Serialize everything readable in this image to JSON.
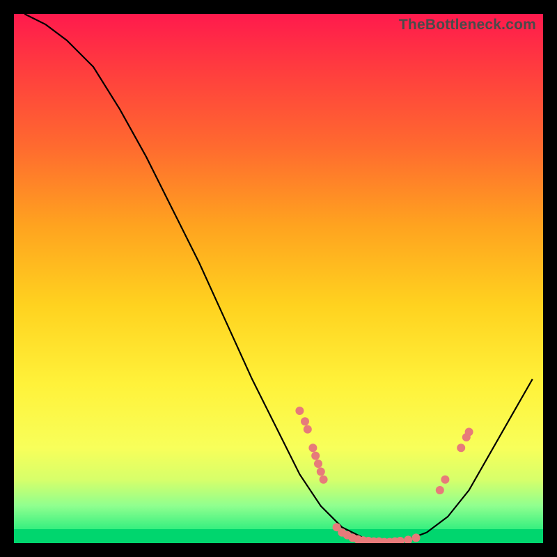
{
  "watermark": "TheBottleneck.com",
  "colors": {
    "dot": "#e77a7a",
    "curve": "#000000"
  },
  "chart_data": {
    "type": "line",
    "title": "",
    "xlabel": "",
    "ylabel": "",
    "xlim": [
      0,
      100
    ],
    "ylim": [
      0,
      100
    ],
    "curve": [
      {
        "x": 2,
        "y": 100
      },
      {
        "x": 6,
        "y": 98
      },
      {
        "x": 10,
        "y": 95
      },
      {
        "x": 15,
        "y": 90
      },
      {
        "x": 20,
        "y": 82
      },
      {
        "x": 25,
        "y": 73
      },
      {
        "x": 30,
        "y": 63
      },
      {
        "x": 35,
        "y": 53
      },
      {
        "x": 40,
        "y": 42
      },
      {
        "x": 45,
        "y": 31
      },
      {
        "x": 50,
        "y": 21
      },
      {
        "x": 54,
        "y": 13
      },
      {
        "x": 58,
        "y": 7
      },
      {
        "x": 62,
        "y": 3
      },
      {
        "x": 66,
        "y": 1
      },
      {
        "x": 70,
        "y": 0
      },
      {
        "x": 74,
        "y": 0.5
      },
      {
        "x": 78,
        "y": 2
      },
      {
        "x": 82,
        "y": 5
      },
      {
        "x": 86,
        "y": 10
      },
      {
        "x": 90,
        "y": 17
      },
      {
        "x": 94,
        "y": 24
      },
      {
        "x": 98,
        "y": 31
      }
    ],
    "dots": [
      {
        "x": 54.0,
        "y": 25.0
      },
      {
        "x": 55.0,
        "y": 23.0
      },
      {
        "x": 55.5,
        "y": 21.5
      },
      {
        "x": 56.5,
        "y": 18.0
      },
      {
        "x": 57.0,
        "y": 16.5
      },
      {
        "x": 57.5,
        "y": 15.0
      },
      {
        "x": 58.0,
        "y": 13.5
      },
      {
        "x": 58.5,
        "y": 12.0
      },
      {
        "x": 61.0,
        "y": 3.0
      },
      {
        "x": 62.0,
        "y": 2.0
      },
      {
        "x": 63.0,
        "y": 1.5
      },
      {
        "x": 64.0,
        "y": 1.0
      },
      {
        "x": 65.0,
        "y": 0.7
      },
      {
        "x": 66.0,
        "y": 0.5
      },
      {
        "x": 67.0,
        "y": 0.4
      },
      {
        "x": 68.0,
        "y": 0.3
      },
      {
        "x": 69.0,
        "y": 0.3
      },
      {
        "x": 70.0,
        "y": 0.2
      },
      {
        "x": 71.0,
        "y": 0.2
      },
      {
        "x": 72.0,
        "y": 0.3
      },
      {
        "x": 73.0,
        "y": 0.4
      },
      {
        "x": 74.5,
        "y": 0.6
      },
      {
        "x": 76.0,
        "y": 1.0
      },
      {
        "x": 80.5,
        "y": 10.0
      },
      {
        "x": 81.5,
        "y": 12.0
      },
      {
        "x": 84.5,
        "y": 18.0
      },
      {
        "x": 85.5,
        "y": 20.0
      },
      {
        "x": 86.0,
        "y": 21.0
      }
    ]
  }
}
